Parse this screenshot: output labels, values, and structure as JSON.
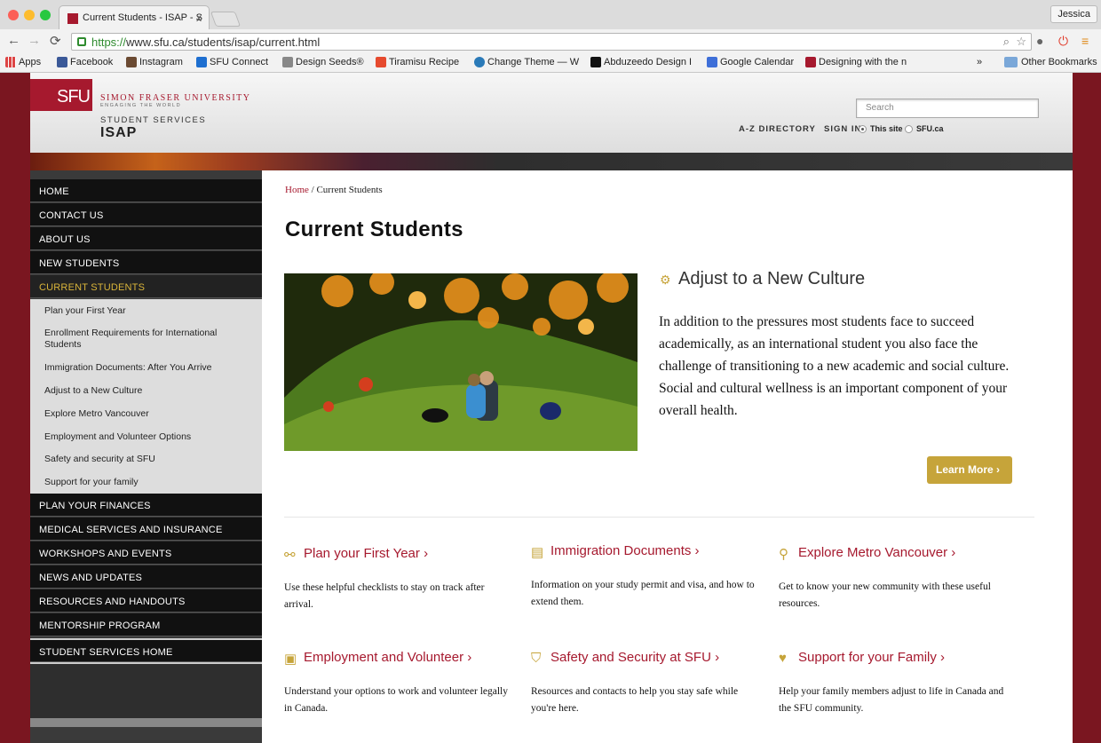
{
  "browser": {
    "tab_title": "Current Students - ISAP - S",
    "tab_close": "x",
    "user": "Jessica",
    "url_https": "https://",
    "url_rest": "www.sfu.ca/students/isap/current.html",
    "bookmarks": [
      "Apps",
      "Facebook",
      "Instagram",
      "SFU Connect",
      "Design Seeds®",
      "Tiramisu Recipe",
      "Change Theme — W",
      "Abduzeedo Design I",
      "Google Calendar",
      "Designing with the n"
    ],
    "other_bookmarks": "Other Bookmarks",
    "overflow": "»"
  },
  "header": {
    "logo": "SFU",
    "university": "SIMON FRASER UNIVERSITY",
    "tagline": "ENGAGING THE WORLD",
    "unit": "STUDENT SERVICES",
    "dept": "ISAP",
    "search_placeholder": "Search",
    "az": "A-Z DIRECTORY",
    "signin": "SIGN IN",
    "radio_site": "This site",
    "radio_sfu": "SFU.ca"
  },
  "sidebar": {
    "top": [
      "HOME",
      "CONTACT US",
      "ABOUT US",
      "NEW STUDENTS"
    ],
    "active": "CURRENT STUDENTS",
    "sub": [
      "Plan your First Year",
      "Enrollment Requirements for International Students",
      "Immigration Documents: After You Arrive",
      "Adjust to a New Culture",
      "Explore Metro Vancouver",
      "Employment and Volunteer Options",
      "Safety and security at SFU",
      "Support for your family"
    ],
    "bottom": [
      "PLAN YOUR FINANCES",
      "MEDICAL SERVICES AND INSURANCE",
      "WORKSHOPS AND EVENTS",
      "NEWS AND UPDATES",
      "RESOURCES AND HANDOUTS",
      "MENTORSHIP PROGRAM",
      "STUDENT SERVICES HOME"
    ]
  },
  "main": {
    "crumb_home": "Home",
    "crumb_sep": " / ",
    "crumb_current": "Current Students",
    "title": "Current Students",
    "feature_title": "Adjust to a New Culture",
    "feature_text": "In addition to the pressures most students face to succeed academically, as an international student you also face the challenge of transitioning to a new academic and social culture. Social and cultural wellness is an important component of your overall health.",
    "learn_more": "Learn More ›",
    "cards": [
      {
        "title": "Plan your First Year ›",
        "text": "Use these helpful checklists to stay on track after arrival.",
        "icon": "sitemap-icon"
      },
      {
        "title": "Immigration Documents ›",
        "text": "Information on your study permit and visa, and how to extend them.",
        "icon": "document-icon"
      },
      {
        "title": "Explore Metro Vancouver ›",
        "text": "Get to know your new community with these useful resources.",
        "icon": "map-pin-icon"
      },
      {
        "title": "Employment and Volunteer ›",
        "text": "Understand your options to work and volunteer legally in Canada.",
        "icon": "briefcase-icon"
      },
      {
        "title": "Safety and Security at SFU ›",
        "text": "Resources and contacts to help you stay safe while you're here.",
        "icon": "shield-icon"
      },
      {
        "title": "Support for your Family ›",
        "text": "Help your family members adjust to life in Canada and the SFU community.",
        "icon": "heart-chat-icon"
      }
    ]
  },
  "colors": {
    "brand_red": "#a6192e",
    "gold": "#c6a43a",
    "sidebar_dark": "#111111"
  }
}
